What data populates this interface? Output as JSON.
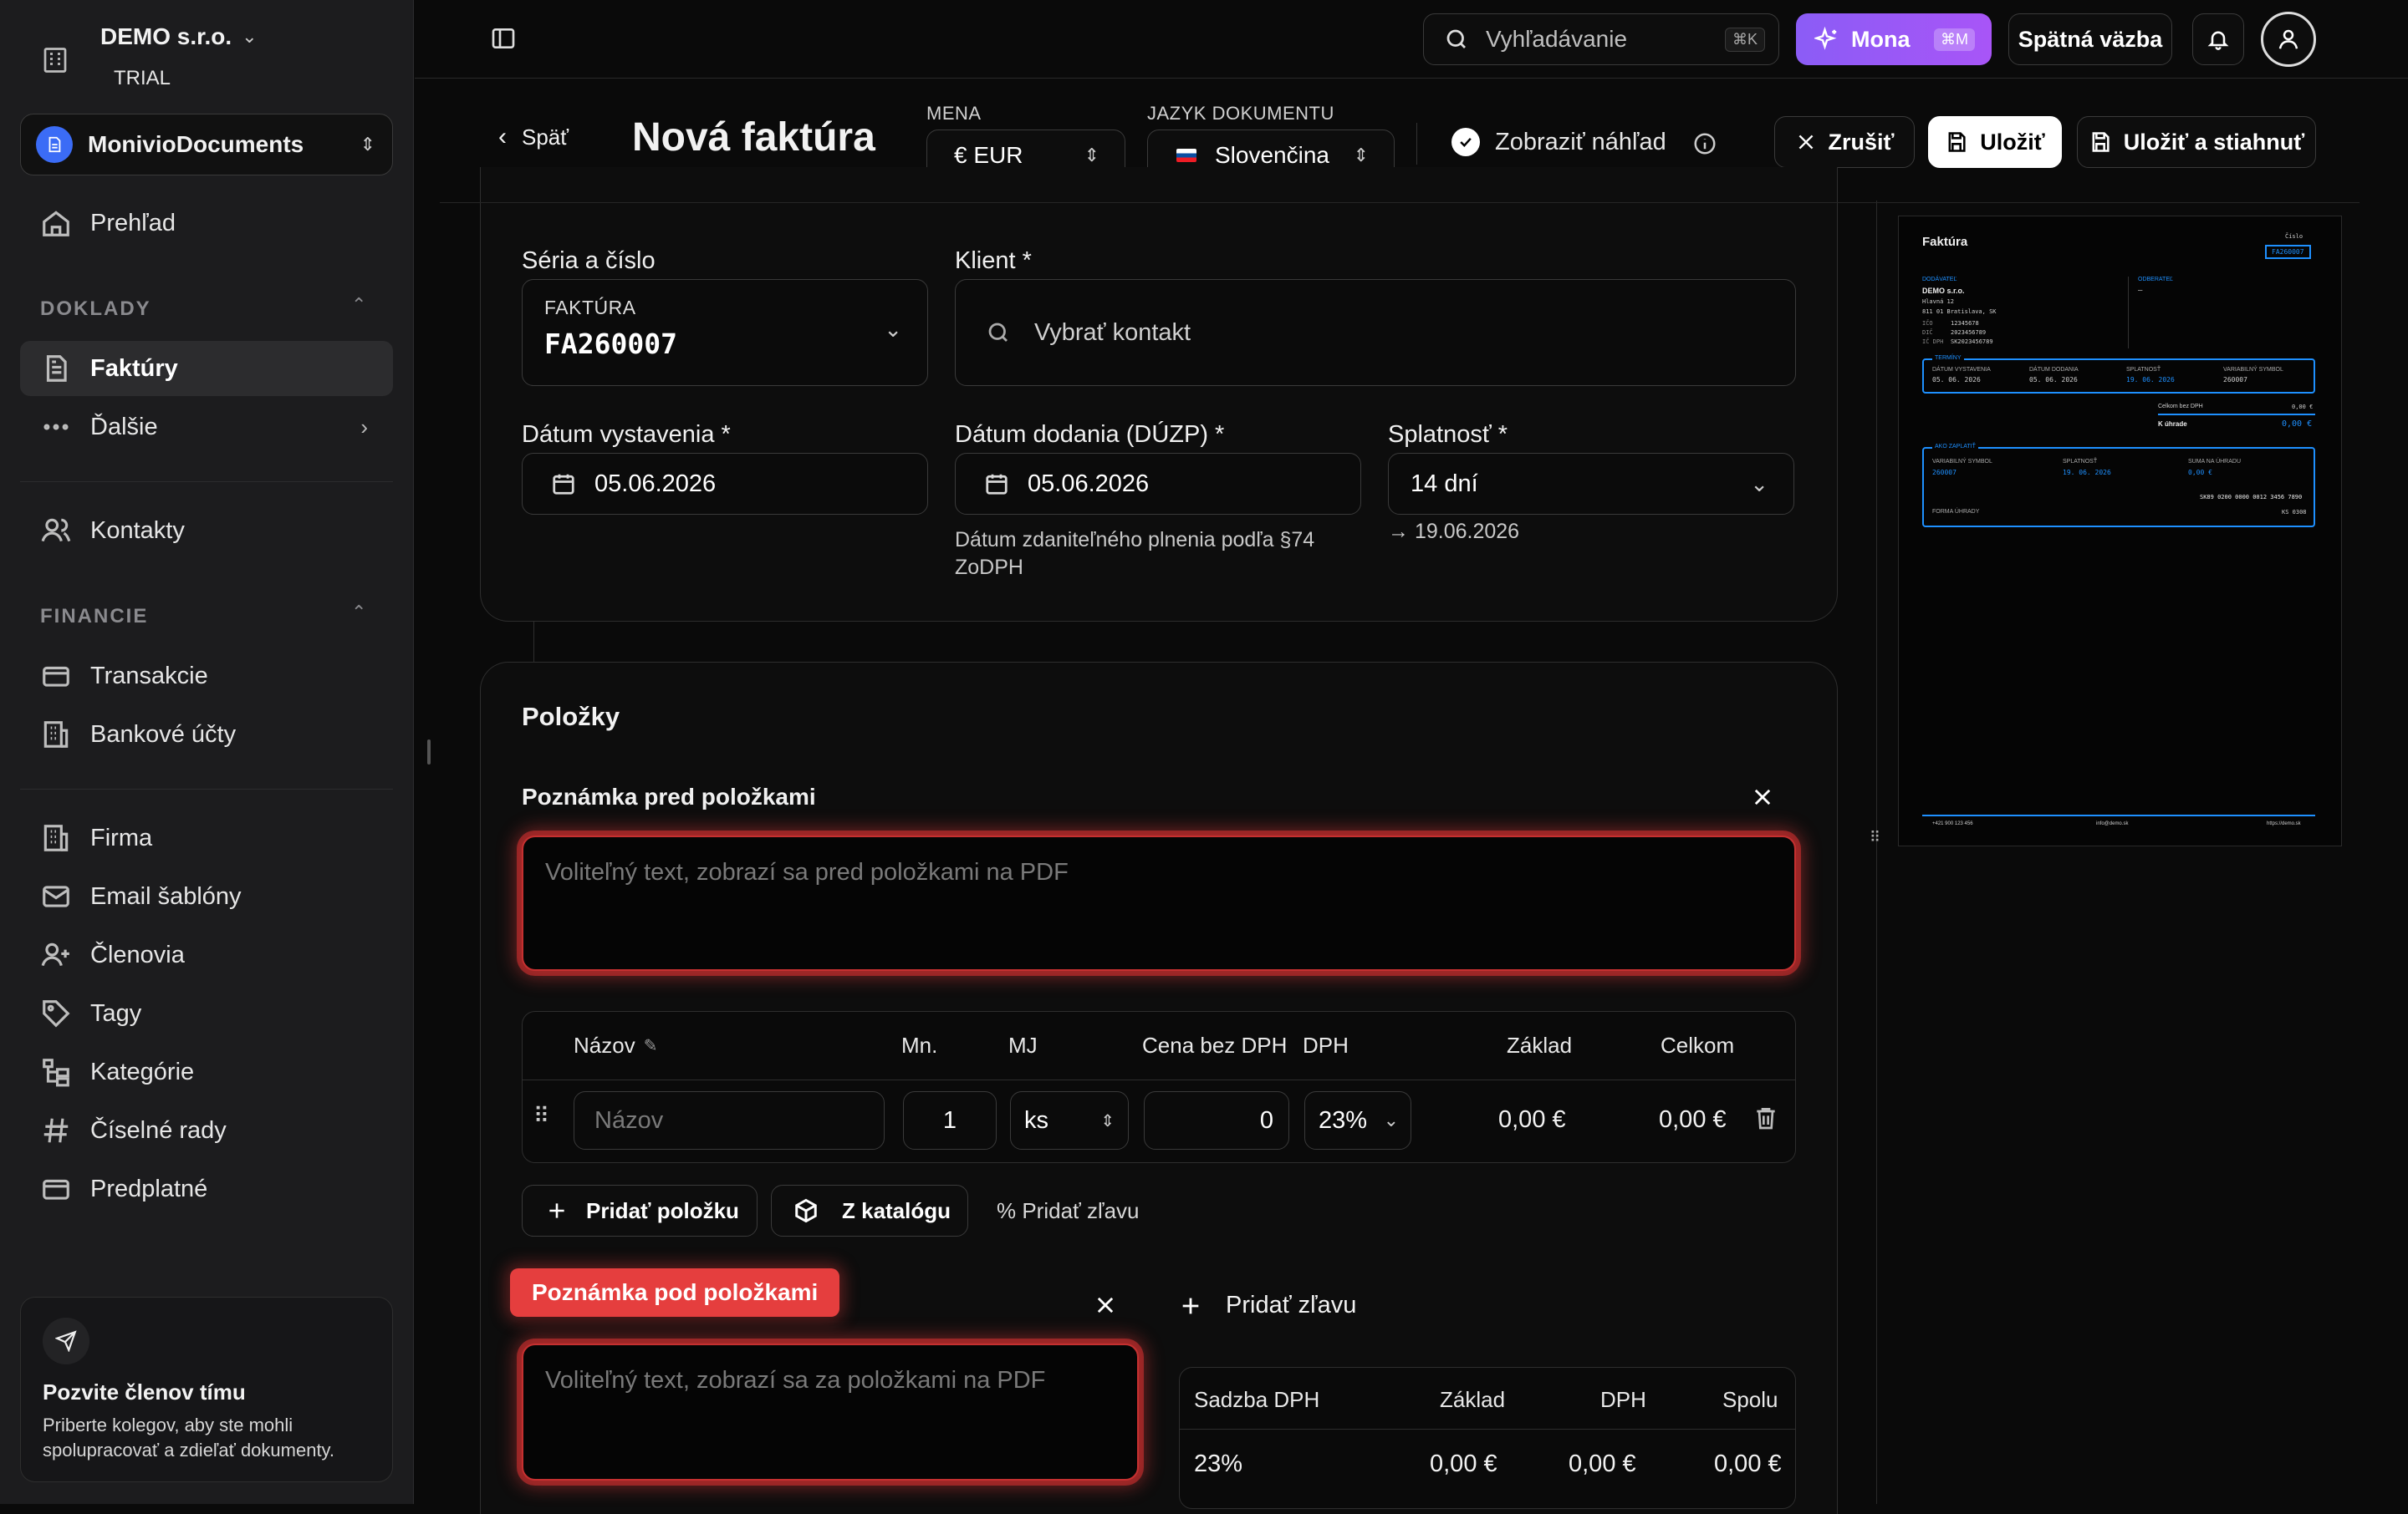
{
  "sidebar": {
    "org_name": "DEMO s.r.o.",
    "org_plan": "TRIAL",
    "workspace": "MonivioDocuments",
    "overview": "Prehľad",
    "section_doklady": "DOKLADY",
    "invoices": "Faktúry",
    "more": "Ďalšie",
    "contacts": "Kontakty",
    "section_finance": "FINANCIE",
    "transactions": "Transakcie",
    "bank_accounts": "Bankové účty",
    "company": "Firma",
    "email_templates": "Email šablóny",
    "members": "Členovia",
    "tags": "Tagy",
    "categories": "Kategórie",
    "number_series": "Číselné rady",
    "subscription": "Predplatné",
    "invite_title": "Pozvite členov tímu",
    "invite_text": "Priberte kolegov, aby ste mohli spolupracovať a zdieľať dokumenty."
  },
  "topbar": {
    "search_placeholder": "Vyhľadávanie",
    "search_shortcut": "⌘K",
    "mona_label": "Mona",
    "mona_shortcut": "⌘M",
    "feedback_label": "Spätná väzba"
  },
  "header": {
    "back_label": "Späť",
    "title": "Nová faktúra",
    "currency_label": "MENA",
    "currency_value": "€ EUR",
    "language_label": "JAZYK DOKUMENTU",
    "language_value": "Slovenčina",
    "preview_toggle": "Zobraziť náhľad",
    "cancel_label": "Zrušiť",
    "save_label": "Uložiť",
    "save_download_label": "Uložiť a stiahnuť"
  },
  "details": {
    "series_label": "Séria a číslo",
    "series_type": "FAKTÚRA",
    "series_number": "FA260007",
    "client_label": "Klient *",
    "client_placeholder": "Vybrať kontakt",
    "issue_date_label": "Dátum vystavenia *",
    "issue_date": "05.06.2026",
    "delivery_date_label": "Dátum dodania (DÚZP) *",
    "delivery_date": "05.06.2026",
    "delivery_help_1": "Dátum zdaniteľného plnenia podľa §74",
    "delivery_help_2": "ZoDPH",
    "due_label": "Splatnosť *",
    "due_value": "14 dní",
    "due_date": "→ 19.06.2026"
  },
  "items": {
    "section_title": "Položky",
    "note_before_label": "Poznámka pred položkami",
    "note_before_placeholder": "Voliteľný text, zobrazí sa pred položkami na PDF",
    "columns": [
      "Názov",
      "Mn.",
      "MJ",
      "Cena bez DPH",
      "DPH",
      "Základ",
      "Celkom"
    ],
    "row": {
      "name_placeholder": "Názov",
      "qty": "1",
      "unit": "ks",
      "price": "0",
      "vat": "23%",
      "base": "0,00 €",
      "total": "0,00 €"
    },
    "add_item": "Pridať položku",
    "from_catalog": "Z katalógu",
    "add_discount_small": "% Pridať zľavu",
    "note_after_label": "Poznámka pod položkami",
    "note_after_placeholder": "Voliteľný text, zobrazí sa za položkami na PDF",
    "add_discount": "Pridať zľavu",
    "vat_table_headers": [
      "Sadzba DPH",
      "Základ",
      "DPH",
      "Spolu"
    ],
    "vat_row": [
      "23%",
      "0,00 €",
      "0,00 €",
      "0,00 €"
    ]
  },
  "preview": {
    "title": "Faktúra",
    "number_label": "Číslo",
    "number": "FA260007",
    "supplier_label": "DODÁVATEĽ",
    "customer_label": "ODBERATEĽ",
    "supplier_name": "DEMO s.r.o.",
    "supplier_street": "Hlavná 12",
    "supplier_city": "811 01 Bratislava, SK",
    "ico_label": "IČO",
    "ico": "12345678",
    "dic_label": "DIČ",
    "dic": "2023456789",
    "icdph_label": "IČ DPH",
    "icdph": "SK2023456789",
    "customer_value": "—",
    "terms_label": "TERMÍNY",
    "terms_headers": [
      "DÁTUM VYSTAVENIA",
      "DÁTUM DODANIA",
      "SPLATNOSŤ",
      "VARIABILNÝ SYMBOL"
    ],
    "terms_values": [
      "05. 06. 2026",
      "05. 06. 2026",
      "19. 06. 2026",
      "260007"
    ],
    "sum_label": "Celkom bez DPH",
    "sum_value": "0,00 €",
    "due_label": "K úhrade",
    "due_value": "0,00 €",
    "pay_label": "AKO ZAPLATIŤ",
    "pay_headers": [
      "VARIABILNÝ SYMBOL",
      "SPLATNOSŤ",
      "SUMA NA ÚHRADU"
    ],
    "pay_values": [
      "260007",
      "19. 06. 2026",
      "0,00 €"
    ],
    "iban": "SK89 0200 0000 0012 3456 7890",
    "pay_method_label": "FORMA ÚHRADY",
    "swift": "KS 0308",
    "footer_phone": "+421 900 123 456",
    "footer_email": "info@demo.sk",
    "footer_web": "https://demo.sk"
  },
  "colors": {
    "accent_red": "#e53e3e",
    "mona_purple": "#8b5cf6",
    "preview_blue": "#1e90ff"
  }
}
